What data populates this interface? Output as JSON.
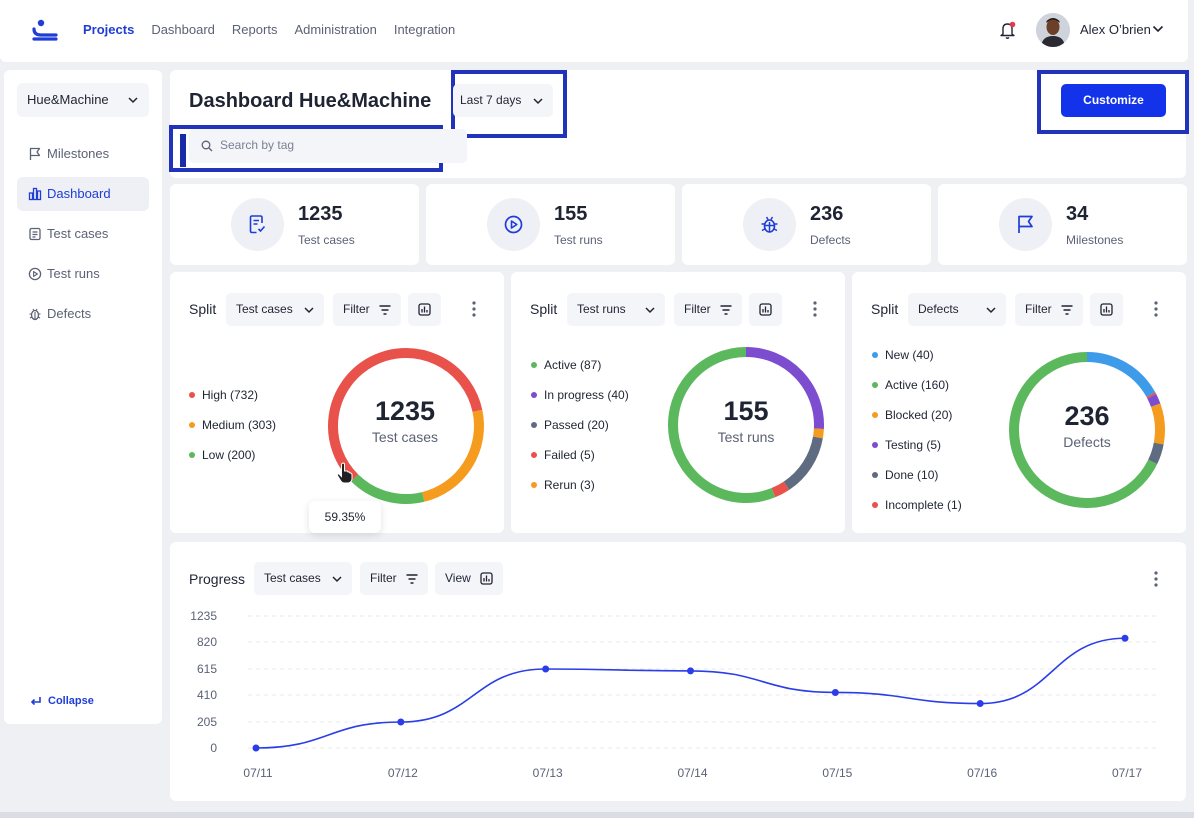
{
  "nav": {
    "items": [
      "Projects",
      "Dashboard",
      "Reports",
      "Administration",
      "Integration"
    ],
    "active": "Projects"
  },
  "user": {
    "name": "Alex O’brien"
  },
  "sidebar": {
    "project": "Hue&Machine",
    "items": [
      {
        "label": "Milestones",
        "icon": "flag-icon"
      },
      {
        "label": "Dashboard",
        "icon": "bar-chart-icon",
        "active": true
      },
      {
        "label": "Test cases",
        "icon": "document-icon"
      },
      {
        "label": "Test runs",
        "icon": "play-circle-icon"
      },
      {
        "label": "Defects",
        "icon": "bug-icon"
      }
    ],
    "collapse": "Collapse"
  },
  "header": {
    "title": "Dashboard Hue&Machine",
    "date_range": "Last 7 days",
    "search_placeholder": "Search by tag",
    "customize": "Customize"
  },
  "stats": [
    {
      "value": "1235",
      "label": "Test cases",
      "icon": "document-check-icon"
    },
    {
      "value": "155",
      "label": "Test runs",
      "icon": "play-circle-icon"
    },
    {
      "value": "236",
      "label": "Defects",
      "icon": "bug-icon"
    },
    {
      "value": "34",
      "label": "Milestones",
      "icon": "flag-icon"
    }
  ],
  "split_panels": [
    {
      "title": "Split",
      "select": "Test cases",
      "filter": "Filter",
      "center_value": "1235",
      "center_label": "Test cases",
      "tooltip": "59.35%",
      "legend": [
        {
          "label": "High (732)",
          "color": "#e9524a"
        },
        {
          "label": "Medium (303)",
          "color": "#f59c1f"
        },
        {
          "label": "Low (200)",
          "color": "#5cb85c"
        }
      ]
    },
    {
      "title": "Split",
      "select": "Test runs",
      "filter": "Filter",
      "center_value": "155",
      "center_label": "Test runs",
      "legend": [
        {
          "label": "Active (87)",
          "color": "#5cb85c"
        },
        {
          "label": "In progress (40)",
          "color": "#7c4dcf"
        },
        {
          "label": "Passed (20)",
          "color": "#5f6b80"
        },
        {
          "label": "Failed (5)",
          "color": "#e9524a"
        },
        {
          "label": "Rerun (3)",
          "color": "#f59c1f"
        }
      ]
    },
    {
      "title": "Split",
      "select": "Defects",
      "filter": "Filter",
      "center_value": "236",
      "center_label": "Defects",
      "legend": [
        {
          "label": "New (40)",
          "color": "#3d9be9"
        },
        {
          "label": "Active (160)",
          "color": "#5cb85c"
        },
        {
          "label": "Blocked (20)",
          "color": "#f59c1f"
        },
        {
          "label": "Testing (5)",
          "color": "#7c4dcf"
        },
        {
          "label": "Done (10)",
          "color": "#5f6b80"
        },
        {
          "label": "Incomplete (1)",
          "color": "#e9524a"
        }
      ]
    }
  ],
  "progress": {
    "title": "Progress",
    "select": "Test cases",
    "filter": "Filter",
    "view": "View"
  },
  "chart_data": {
    "type": "line",
    "x": [
      "07/11",
      "07/12",
      "07/13",
      "07/14",
      "07/15",
      "07/16",
      "07/17"
    ],
    "series": [
      {
        "values": [
          0,
          205,
          615,
          600,
          430,
          345,
          880
        ]
      }
    ],
    "yticks": [
      0,
      205,
      410,
      615,
      820,
      1235
    ],
    "ylim": [
      0,
      1235
    ],
    "grid": true,
    "color": "#2a3de8"
  },
  "donut_data": [
    {
      "segments": [
        {
          "value": 732,
          "color": "#e9524a"
        },
        {
          "value": 303,
          "color": "#f59c1f"
        },
        {
          "value": 200,
          "color": "#5cb85c"
        }
      ]
    },
    {
      "segments": [
        {
          "value": 40,
          "color": "#7c4dcf"
        },
        {
          "value": 3,
          "color": "#f59c1f"
        },
        {
          "value": 20,
          "color": "#5f6b80"
        },
        {
          "value": 5,
          "color": "#e9524a"
        },
        {
          "value": 87,
          "color": "#5cb85c"
        }
      ]
    },
    {
      "segments": [
        {
          "value": 40,
          "color": "#3d9be9"
        },
        {
          "value": 1,
          "color": "#e9524a"
        },
        {
          "value": 5,
          "color": "#7c4dcf"
        },
        {
          "value": 20,
          "color": "#f59c1f"
        },
        {
          "value": 10,
          "color": "#5f6b80"
        },
        {
          "value": 160,
          "color": "#5cb85c"
        }
      ]
    }
  ]
}
